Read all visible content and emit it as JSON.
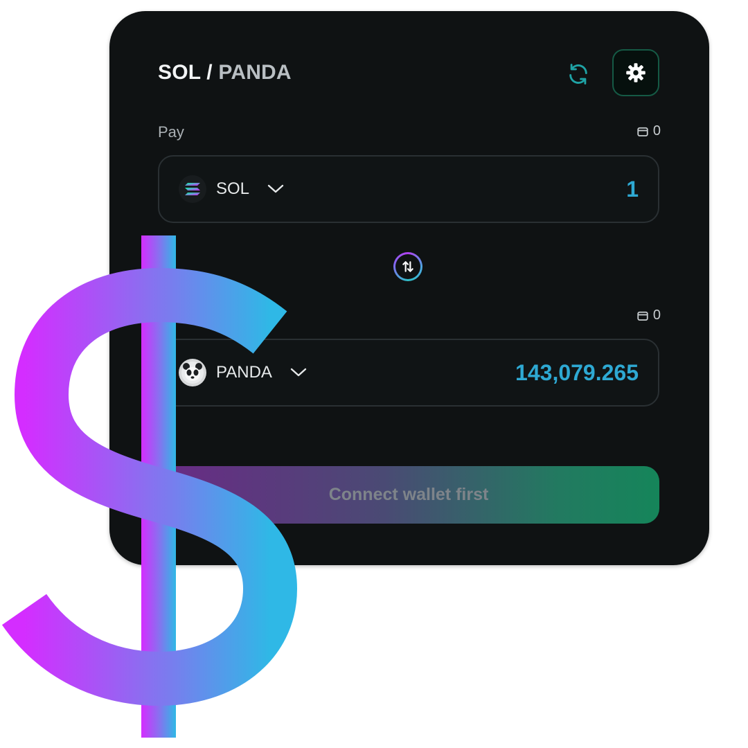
{
  "header": {
    "pair_base": "SOL",
    "pair_separator": " / ",
    "pair_quote": "PANDA"
  },
  "pay": {
    "label": "Pay",
    "balance": "0",
    "token_symbol": "SOL",
    "amount": "1"
  },
  "receive": {
    "balance": "0",
    "token_symbol": "PANDA",
    "amount": "143,079.265"
  },
  "connect_button": {
    "label": "Connect wallet first"
  },
  "icons": {
    "refresh": "refresh-icon",
    "settings": "gear-icon",
    "wallet": "wallet-icon",
    "chevron": "chevron-down-icon",
    "switch": "swap-arrows-icon",
    "sol_logo": "sol-logo",
    "panda_logo": "panda-logo",
    "overlay": "dollar-sign"
  },
  "colors": {
    "card_bg": "#0f1213",
    "accent_amount": "#2ea9d3",
    "settings_border": "#155a45",
    "dollar_gradient_start": "#d42dff",
    "dollar_gradient_end": "#2fb8e6"
  }
}
